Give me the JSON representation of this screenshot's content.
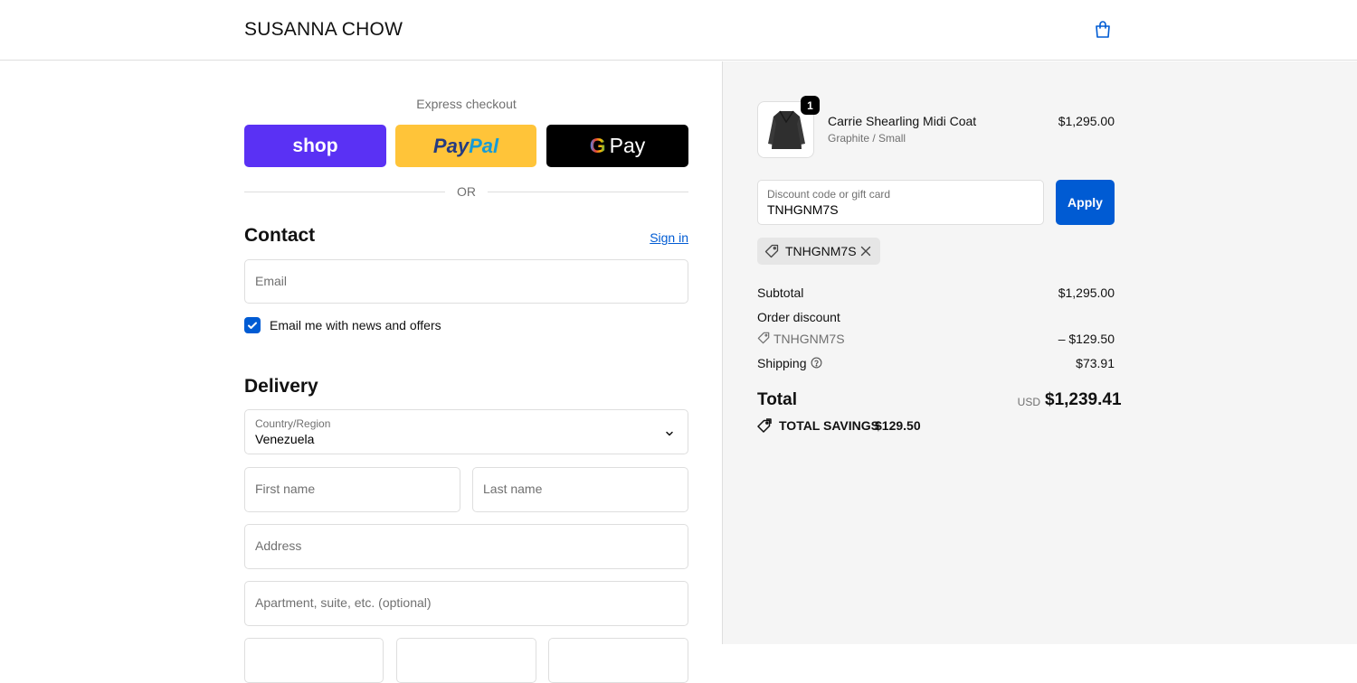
{
  "header": {
    "brand": "SUSANNA CHOW",
    "cart_icon": "shopping-bag-icon"
  },
  "express": {
    "title": "Express checkout",
    "shop_label": "shop",
    "paypal_label_1": "Pay",
    "paypal_label_2": "Pal",
    "gpay_g": "G",
    "gpay_label": "Pay",
    "or_text": "OR"
  },
  "contact": {
    "heading": "Contact",
    "sign_in": "Sign in",
    "email_placeholder": "Email",
    "news_label": "Email me with news and offers",
    "news_checked": true
  },
  "delivery": {
    "heading": "Delivery",
    "country_label": "Country/Region",
    "country_value": "Venezuela",
    "first_name_placeholder": "First name",
    "last_name_placeholder": "Last name",
    "address_placeholder": "Address",
    "apartment_placeholder": "Apartment, suite, etc. (optional)"
  },
  "summary": {
    "item": {
      "name": "Carrie Shearling Midi Coat",
      "variant": "Graphite / Small",
      "price": "$1,295.00",
      "quantity": "1"
    },
    "discount_label": "Discount code or gift card",
    "discount_value": "TNHGNM7S",
    "apply_label": "Apply",
    "applied_code": "TNHGNM7S",
    "subtotal_label": "Subtotal",
    "subtotal_value": "$1,295.00",
    "order_discount_label": "Order discount",
    "order_discount_code": "TNHGNM7S",
    "order_discount_value": "– $129.50",
    "shipping_label": "Shipping",
    "shipping_value": "$73.91",
    "total_label": "Total",
    "total_currency": "USD",
    "total_value": "$1,239.41",
    "savings_label": "TOTAL SAVINGS",
    "savings_value": "$129.50"
  },
  "colors": {
    "accent": "#005bd3",
    "shop": "#5a31f4",
    "paypal": "#ffc439",
    "panel": "#f5f5f5"
  }
}
